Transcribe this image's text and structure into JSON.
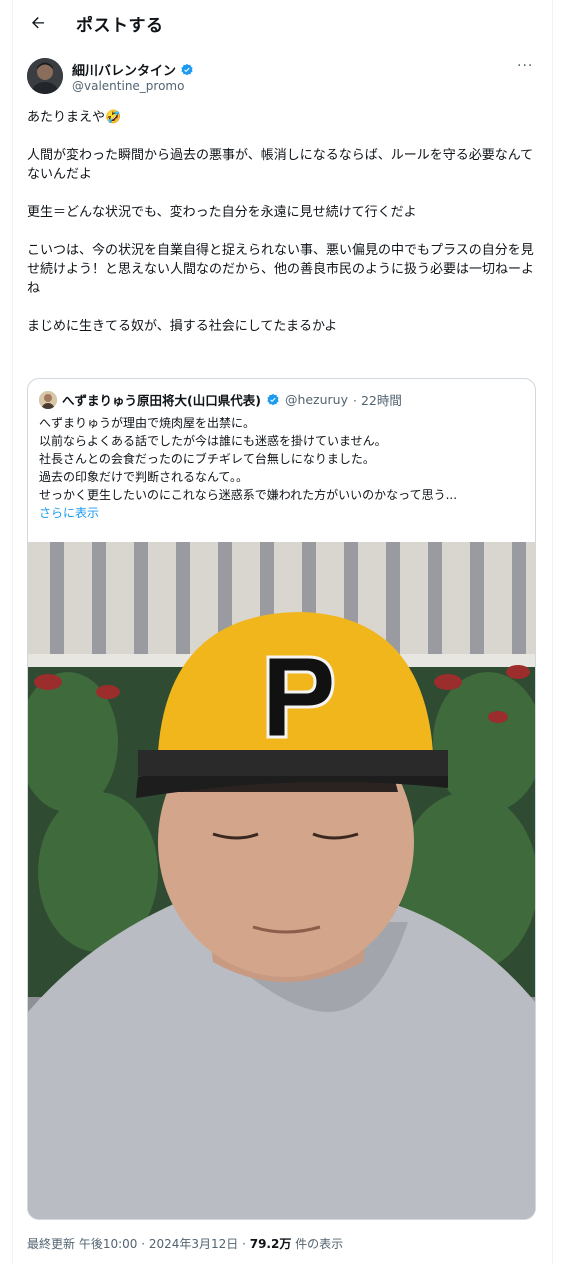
{
  "header": {
    "back_icon": "arrow-left-icon",
    "title": "ポストする"
  },
  "author": {
    "name": "細川バレンタイン",
    "handle": "@valentine_promo",
    "verified_icon": "verified-badge-icon",
    "verified_color": "#1d9bf0",
    "more_icon": "more-horizontal-icon",
    "more_label": "···"
  },
  "post": {
    "paragraphs": [
      "あたりまえや🤣",
      "人間が変わった瞬間から過去の悪事が、帳消しになるならば、ルールを守る必要なんてないんだよ",
      "更生＝どんな状況でも、変わった自分を永遠に見せ続けて行くだよ",
      "こいつは、今の状況を自業自得と捉えられない事、悪い偏見の中でもプラスの自分を見せ続けよう！と思えない人間なのだから、他の善良市民のように扱う必要は一切ねーよね",
      "まじめに生きてる奴が、損する社会にしてたまるかよ"
    ]
  },
  "quote": {
    "name": "へずまりゅう原田将大(山口県代表)",
    "handle": "@hezuruy",
    "time": "· 22時間",
    "lines": [
      "へずまりゅうが理由で焼肉屋を出禁に。",
      "以前ならよくある話でしたが今は誰にも迷惑を掛けていません。",
      "社長さんとの会食だったのにブチギレて台無しになりました。",
      "過去の印象だけで判断されるなんて。。",
      "せっかく更生したいのにこれなら迷惑系で嫌われた方がいいのかなって思う..."
    ],
    "show_more": "さらに表示",
    "photo_icon": "photo-man-yellow-cap"
  },
  "footer": {
    "prefix": "最終更新 午後10:00 · 2024年3月12日 · ",
    "views": "79.2万",
    "suffix": " 件の表示"
  }
}
